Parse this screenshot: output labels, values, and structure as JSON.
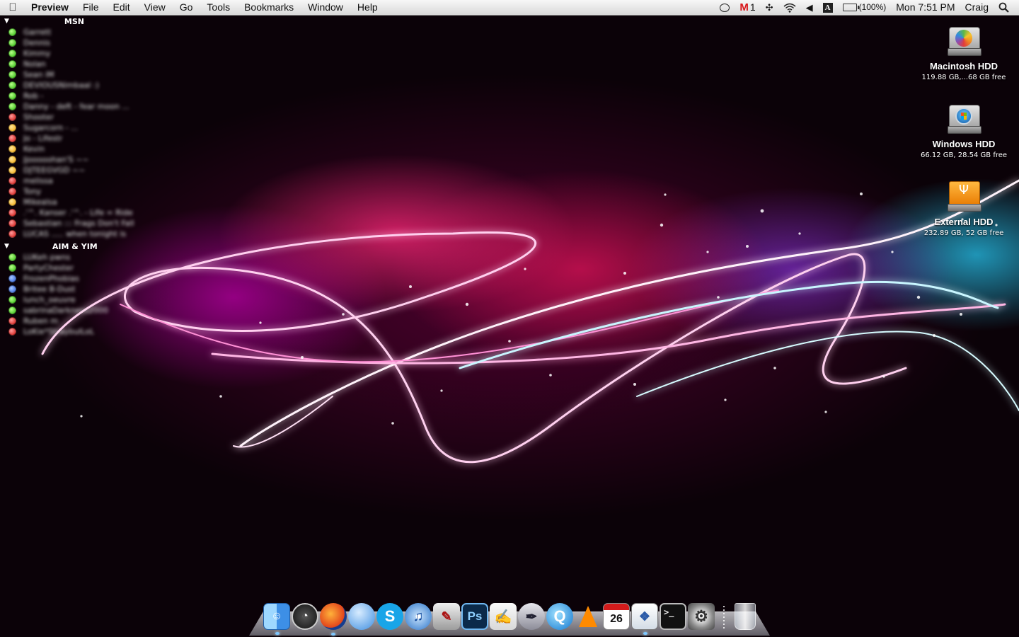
{
  "menubar": {
    "app_name": "Preview",
    "menus": [
      "File",
      "Edit",
      "View",
      "Go",
      "Tools",
      "Bookmarks",
      "Window",
      "Help"
    ],
    "status": {
      "gmail_count": "1",
      "battery": "(100%)",
      "clock": "Mon 7:51 PM",
      "user": "Craig"
    },
    "icons": [
      "apple-icon",
      "chat-bubble-icon",
      "gmail-icon",
      "bluetooth-icon",
      "wifi-icon",
      "volume-icon",
      "input-menu-icon",
      "battery-icon",
      "spotlight-icon"
    ]
  },
  "contacts": {
    "groups": [
      {
        "name": "MSN",
        "contacts": [
          {
            "name": "Garrett",
            "status": "online"
          },
          {
            "name": "Dennis",
            "status": "online"
          },
          {
            "name": "Kimmy",
            "status": "online"
          },
          {
            "name": "Nolan",
            "status": "online"
          },
          {
            "name": "Sean iM",
            "status": "online"
          },
          {
            "name": "DEVIOUSNimbaal :)",
            "status": "online"
          },
          {
            "name": "Rob -",
            "status": "online"
          },
          {
            "name": "Danny - deft - fear moon ...",
            "status": "online"
          },
          {
            "name": "Shooter",
            "status": "busy"
          },
          {
            "name": "Sugarcorn - ...",
            "status": "away"
          },
          {
            "name": "Jo - Lifestr",
            "status": "busy"
          },
          {
            "name": "Kevin",
            "status": "away"
          },
          {
            "name": "Jjooooohan'S ~~",
            "status": "away"
          },
          {
            "name": "DJTEEGVGD ~~",
            "status": "away"
          },
          {
            "name": "melissa",
            "status": "busy"
          },
          {
            "name": "Tony",
            "status": "busy"
          },
          {
            "name": "Mikealsa",
            "status": "away"
          },
          {
            "name": ".'^. Kanser .'^. - Life = Ride",
            "status": "busy"
          },
          {
            "name": "Sebastian ::: Frags Don't Fall",
            "status": "busy"
          },
          {
            "name": "LUCAS ..... when tonight is",
            "status": "busy"
          }
        ]
      },
      {
        "name": "AIM & YIM",
        "contacts": [
          {
            "name": "LUKeh pwns",
            "status": "online"
          },
          {
            "name": "PartyChester",
            "status": "online"
          },
          {
            "name": "FrozenPhobias",
            "status": "mobile"
          },
          {
            "name": "Britee B-Dust",
            "status": "mobile"
          },
          {
            "name": "lunch_oeuvre",
            "status": "online"
          },
          {
            "name": "sabrinaDarkness2000",
            "status": "online"
          },
          {
            "name": "Ruben m",
            "status": "busy"
          },
          {
            "name": "LoKie*StraybulLoL",
            "status": "busy"
          }
        ]
      }
    ],
    "status_colors": {
      "online": "#2fb80f",
      "away": "#f2a60b",
      "busy": "#d0140f",
      "mobile": "#2d5fd8"
    }
  },
  "desktop": {
    "drives": [
      {
        "name": "Macintosh HDD",
        "info": "119.88 GB,...68 GB free",
        "icon": "macintosh-hdd-icon"
      },
      {
        "name": "Windows HDD",
        "info": "66.12 GB, 28.54 GB free",
        "icon": "windows-hdd-icon"
      },
      {
        "name": "External HDD",
        "info": "232.89 GB, 52 GB free",
        "icon": "usb-drive-icon"
      }
    ]
  },
  "dock": {
    "items": [
      {
        "name": "finder-icon",
        "glyph": "☺"
      },
      {
        "name": "dashboard-icon",
        "glyph": "◔"
      },
      {
        "name": "firefox-icon",
        "glyph": ""
      },
      {
        "name": "ichat-icon",
        "glyph": ""
      },
      {
        "name": "skype-icon",
        "glyph": "S"
      },
      {
        "name": "itunes-icon",
        "glyph": "♫"
      },
      {
        "name": "script-editor-icon",
        "glyph": "✎"
      },
      {
        "name": "photoshop-icon",
        "glyph": "Ps"
      },
      {
        "name": "textedit-icon",
        "glyph": "✍"
      },
      {
        "name": "pen-tool-icon",
        "glyph": "✒"
      },
      {
        "name": "quicktime-icon",
        "glyph": "Q"
      },
      {
        "name": "vlc-icon",
        "glyph": ""
      },
      {
        "name": "ical-icon",
        "glyph": "26"
      },
      {
        "name": "preview-icon",
        "glyph": "❖"
      },
      {
        "name": "terminal-icon",
        "glyph": ">_"
      },
      {
        "name": "system-preferences-icon",
        "glyph": "⚙"
      }
    ],
    "trash": {
      "name": "trash-icon"
    }
  }
}
